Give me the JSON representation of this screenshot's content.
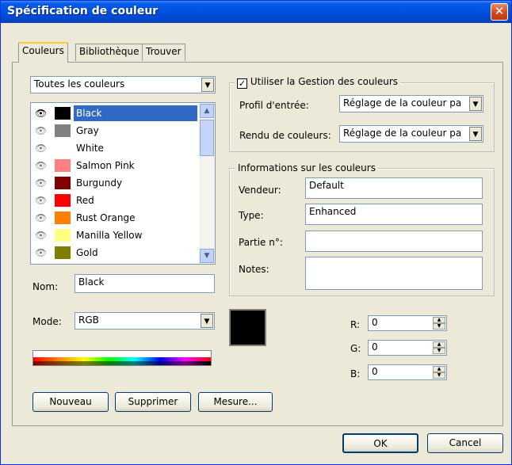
{
  "window": {
    "title": "Spécification de couleur",
    "close": "✕"
  },
  "tabs": [
    {
      "label": "Couleurs",
      "active": true
    },
    {
      "label": "Bibliothèque",
      "active": false
    },
    {
      "label": "Trouver",
      "active": false
    }
  ],
  "colors_panel": {
    "filter_value": "Toutes les couleurs",
    "list": [
      {
        "name": "Black",
        "color": "#000000",
        "selected": true
      },
      {
        "name": "Gray",
        "color": "#808080",
        "selected": false
      },
      {
        "name": "White",
        "color": "#ffffff",
        "selected": false
      },
      {
        "name": "Salmon Pink",
        "color": "#ff8080",
        "selected": false
      },
      {
        "name": "Burgundy",
        "color": "#800000",
        "selected": false
      },
      {
        "name": "Red",
        "color": "#ff0000",
        "selected": false
      },
      {
        "name": "Rust Orange",
        "color": "#ff8000",
        "selected": false
      },
      {
        "name": "Manilla Yellow",
        "color": "#ffff80",
        "selected": false
      },
      {
        "name": "Gold",
        "color": "#808000",
        "selected": false
      }
    ],
    "name_label": "Nom:",
    "name_value": "Black",
    "mode_label": "Mode:",
    "mode_value": "RGB",
    "preview_color": "#000000"
  },
  "color_management": {
    "checkbox_label": "Utiliser la Gestion des couleurs",
    "checked": true,
    "input_profile_label": "Profil d'entrée:",
    "input_profile_value": "Réglage de la couleur pa",
    "rendering_label": "Rendu de couleurs:",
    "rendering_value": "Réglage de la couleur pa"
  },
  "color_info": {
    "group_title": "Informations sur les couleurs",
    "vendor_label": "Vendeur:",
    "vendor_value": "Default",
    "type_label": "Type:",
    "type_value": "Enhanced",
    "part_label": "Partie n°:",
    "part_value": "",
    "notes_label": "Notes:",
    "notes_value": ""
  },
  "rgb": {
    "r_label": "R:",
    "r_value": "0",
    "g_label": "G:",
    "g_value": "0",
    "b_label": "B:",
    "b_value": "0"
  },
  "buttons": {
    "new": "Nouveau",
    "delete": "Supprimer",
    "measure": "Mesure...",
    "ok": "OK",
    "cancel": "Cancel"
  },
  "icons": {
    "eye": "eye-icon",
    "dropdown": "chevron-down-icon",
    "scroll_up": "scroll-up-icon",
    "scroll_down": "scroll-down-icon",
    "spin_up": "spin-up-icon",
    "spin_down": "spin-down-icon"
  }
}
